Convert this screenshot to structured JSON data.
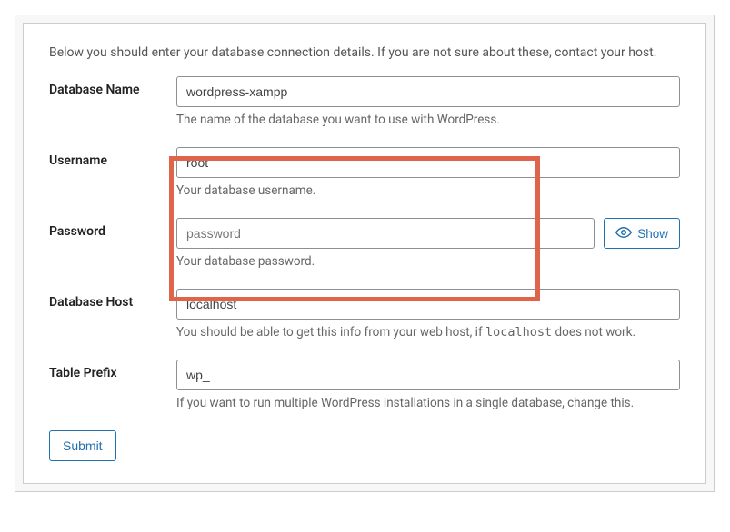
{
  "intro_text": "Below you should enter your database connection details. If you are not sure about these, contact your host.",
  "fields": {
    "dbname": {
      "label": "Database Name",
      "value": "wordpress-xampp",
      "help": "The name of the database you want to use with WordPress."
    },
    "username": {
      "label": "Username",
      "value": "root",
      "help": "Your database username."
    },
    "password": {
      "label": "Password",
      "value": "",
      "placeholder": "password",
      "help": "Your database password.",
      "show_label": "Show"
    },
    "dbhost": {
      "label": "Database Host",
      "value": "localhost",
      "help_part1": "You should be able to get this info from your web host, if ",
      "help_code": "localhost",
      "help_part2": " does not work."
    },
    "prefix": {
      "label": "Table Prefix",
      "value": "wp_",
      "help": "If you want to run multiple WordPress installations in a single database, change this."
    }
  },
  "submit_label": "Submit"
}
